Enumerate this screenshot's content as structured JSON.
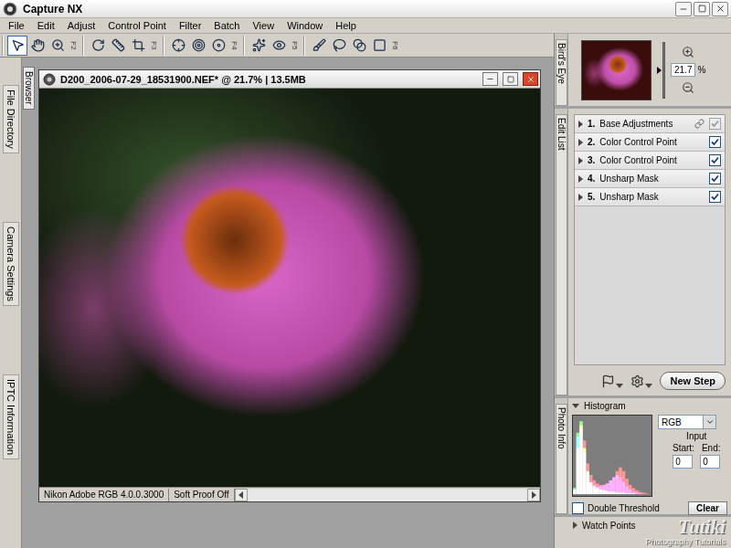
{
  "window": {
    "title": "Capture NX"
  },
  "menu": [
    "File",
    "Edit",
    "Adjust",
    "Control Point",
    "Filter",
    "Batch",
    "View",
    "Window",
    "Help"
  ],
  "toolbar": {
    "groups": [
      {
        "label": "F2",
        "tools": [
          {
            "selected": true
          },
          {
            "selected": false
          },
          {
            "selected": false
          }
        ]
      },
      {
        "label": "F3",
        "tools": [
          {
            "selected": false
          },
          {
            "selected": false
          },
          {
            "selected": false
          }
        ]
      },
      {
        "label": "F4",
        "tools": [
          {
            "selected": false
          },
          {
            "selected": false
          },
          {
            "selected": false
          }
        ]
      },
      {
        "label": "F5",
        "tools": [
          {
            "selected": false
          },
          {
            "selected": false
          }
        ]
      },
      {
        "label": "F6",
        "tools": [
          {
            "selected": false
          },
          {
            "selected": false
          },
          {
            "selected": false
          },
          {
            "selected": false
          }
        ]
      }
    ]
  },
  "left_dock": {
    "tabs": [
      "File Directory",
      "Camera Settings",
      "IPTC Information"
    ]
  },
  "browser": {
    "tab": "Browser"
  },
  "document": {
    "title": "D200_2006-07-29_18531900.NEF* @ 21.7% | 13.5MB",
    "profile": "Nikon Adobe RGB 4.0.0.3000",
    "soft_proof": "Soft Proof Off"
  },
  "birds_eye": {
    "tab": "Bird's Eye",
    "zoom": "21.7",
    "unit": "%"
  },
  "edit_list": {
    "tab": "Edit List",
    "new_step": "New Step",
    "steps": [
      {
        "number": "1.",
        "name": "Base Adjustments",
        "expanded": false,
        "checked": true,
        "disabled": true,
        "linked": true
      },
      {
        "number": "2.",
        "name": "Color Control Point",
        "expanded": false,
        "checked": true,
        "disabled": false,
        "linked": false
      },
      {
        "number": "3.",
        "name": "Color Control Point",
        "expanded": false,
        "checked": true,
        "disabled": false,
        "linked": false
      },
      {
        "number": "4.",
        "name": "Unsharp Mask",
        "expanded": false,
        "checked": true,
        "disabled": false,
        "linked": false
      },
      {
        "number": "5.",
        "name": "Unsharp Mask",
        "expanded": false,
        "checked": true,
        "disabled": false,
        "linked": false
      }
    ]
  },
  "histogram": {
    "tab": "Photo Info",
    "title": "Histogram",
    "expanded": true,
    "channel": "RGB",
    "input_label": "Input",
    "start_label": "Start:",
    "end_label": "End:",
    "start": "0",
    "end": "0",
    "double_threshold": {
      "label": "Double Threshold",
      "checked": false
    },
    "clear": "Clear",
    "series": [
      {
        "color": "#ff3030",
        "values": [
          5,
          60,
          90,
          70,
          40,
          25,
          18,
          14,
          12,
          12,
          14,
          18,
          22,
          30,
          35,
          30,
          20,
          12,
          8,
          5,
          3,
          2,
          1,
          0
        ]
      },
      {
        "color": "#30ff30",
        "values": [
          8,
          80,
          95,
          60,
          30,
          15,
          10,
          8,
          6,
          5,
          4,
          3,
          3,
          2,
          2,
          2,
          1,
          1,
          1,
          0,
          0,
          0,
          0,
          0
        ]
      },
      {
        "color": "#3040ff",
        "values": [
          6,
          75,
          85,
          55,
          28,
          16,
          12,
          10,
          10,
          12,
          14,
          18,
          22,
          25,
          22,
          16,
          10,
          6,
          3,
          2,
          1,
          0,
          0,
          0
        ]
      }
    ]
  },
  "watch_points": {
    "title": "Watch Points",
    "expanded": false
  },
  "watermark": {
    "title": "Tutiki",
    "subtitle": "Photography Tutorials"
  }
}
